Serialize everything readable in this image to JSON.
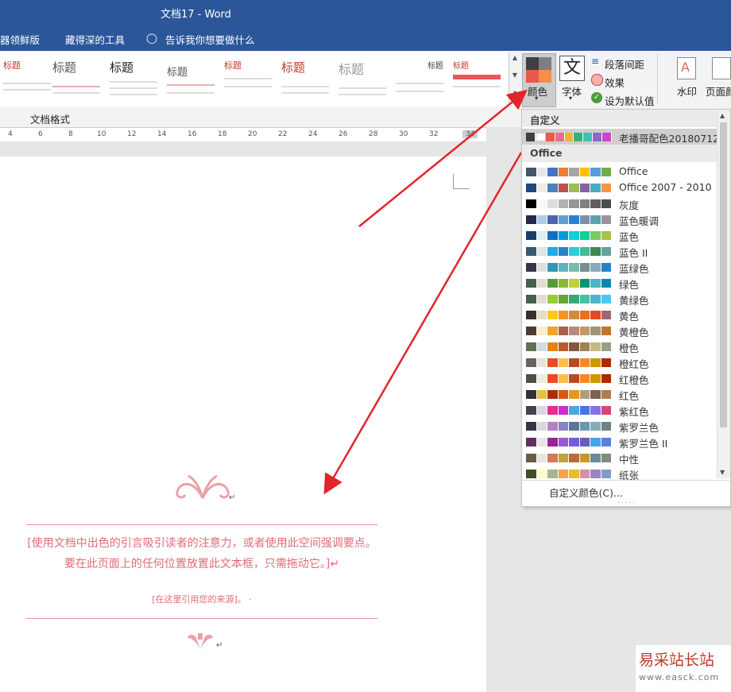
{
  "window": {
    "title": "文档17  -  Word"
  },
  "menubar": [
    "器领鲜版",
    "藏得深的工具",
    "告诉我你想要做什么"
  ],
  "ribbon": {
    "style_thumbs": [
      {
        "heading": "标题"
      },
      {
        "heading": "标题"
      },
      {
        "heading": "标题"
      },
      {
        "heading": "标题"
      },
      {
        "heading": "标题"
      },
      {
        "heading": "标题"
      },
      {
        "heading": "标题"
      },
      {
        "heading": "标题"
      },
      {
        "heading": "标题"
      }
    ],
    "colors_label": "颜色",
    "fonts_label": "字体",
    "paragraph_spacing_label": "段落间距",
    "effects_label": "效果",
    "set_default_label": "设为默认值",
    "watermark_label": "水印",
    "page_color_label": "页面颜",
    "doc_format_label": "文档格式"
  },
  "ruler": [
    "4",
    "6",
    "8",
    "10",
    "12",
    "14",
    "16",
    "18",
    "20",
    "22",
    "24",
    "26",
    "28",
    "30",
    "32",
    "34"
  ],
  "document": {
    "quote": "[使用文档中出色的引言吸引读者的注意力，或者使用此空间强调要点。要在此页面上的任何位置放置此文本框，只需拖动它。]↵",
    "source": "[在这里引用您的来源]。 ·",
    "para_mark": "↵"
  },
  "dropdown": {
    "custom_header": "自定义",
    "custom_items": [
      {
        "name": "老播哥配色20180712",
        "colors": [
          "#404040",
          "#ffffff",
          "#e8584b",
          "#ef6b88",
          "#f4b233",
          "#2fb37a",
          "#3dc0b4",
          "#9066c6",
          "#cc44cc"
        ]
      }
    ],
    "office_header": "Office",
    "office_items": [
      {
        "name": "Office",
        "colors": [
          "#44546a",
          "#e7e6e6",
          "#4472c4",
          "#ed7d31",
          "#a5a5a5",
          "#ffc000",
          "#5b9bd5",
          "#70ad47"
        ]
      },
      {
        "name": "Office 2007 - 2010",
        "colors": [
          "#1f497d",
          "#eeece1",
          "#4f81bd",
          "#c0504d",
          "#9bbb59",
          "#8064a2",
          "#4bacc6",
          "#f79646"
        ]
      },
      {
        "name": "灰度",
        "colors": [
          "#000000",
          "#f8f8f8",
          "#dddddd",
          "#b2b2b2",
          "#969696",
          "#808080",
          "#5f5f5f",
          "#4d4d4d"
        ]
      },
      {
        "name": "蓝色暖调",
        "colors": [
          "#242852",
          "#acccea",
          "#4a66ac",
          "#629dd1",
          "#297fd5",
          "#7f8fa9",
          "#5aa2ae",
          "#9d90a0"
        ]
      },
      {
        "name": "蓝色",
        "colors": [
          "#17406d",
          "#dbeff9",
          "#0f6fc6",
          "#009dd9",
          "#0bd0d9",
          "#10cf9b",
          "#7cca62",
          "#a5c249"
        ]
      },
      {
        "name": "蓝色 II",
        "colors": [
          "#335b74",
          "#dfe3e5",
          "#1cade4",
          "#2683c6",
          "#27ced7",
          "#42ba97",
          "#3e8853",
          "#62a39f"
        ]
      },
      {
        "name": "蓝绿色",
        "colors": [
          "#373545",
          "#dedede",
          "#3494ba",
          "#58b6c0",
          "#75bda7",
          "#7a8c8e",
          "#84acb6",
          "#2683c6"
        ]
      },
      {
        "name": "绿色",
        "colors": [
          "#455f51",
          "#e3ded1",
          "#549e39",
          "#8ab833",
          "#c0cf3a",
          "#029676",
          "#4ab5c4",
          "#0989b1"
        ]
      },
      {
        "name": "黄绿色",
        "colors": [
          "#455f51",
          "#e3ded1",
          "#99cb38",
          "#63a537",
          "#37a76f",
          "#44c1a3",
          "#4eb3cf",
          "#51c3f9"
        ]
      },
      {
        "name": "黄色",
        "colors": [
          "#39302a",
          "#e5dec9",
          "#ffca08",
          "#f8931d",
          "#ce8d3e",
          "#ec7016",
          "#e64823",
          "#9c6a6a"
        ]
      },
      {
        "name": "黄橙色",
        "colors": [
          "#4e3b30",
          "#fbeec9",
          "#f0a22e",
          "#a5644e",
          "#b58b80",
          "#c3986d",
          "#a19574",
          "#c17529"
        ]
      },
      {
        "name": "橙色",
        "colors": [
          "#637052",
          "#ccddea",
          "#e48312",
          "#bd582c",
          "#865640",
          "#9b8357",
          "#c2bc80",
          "#94a088"
        ]
      },
      {
        "name": "橙红色",
        "colors": [
          "#696464",
          "#e9e5dc",
          "#e84c22",
          "#ffbd47",
          "#b64926",
          "#ff8427",
          "#cc9900",
          "#b22600"
        ]
      },
      {
        "name": "红橙色",
        "colors": [
          "#505046",
          "#eeece1",
          "#e84c22",
          "#ffbd47",
          "#b64926",
          "#ff8427",
          "#cc9900",
          "#b22600"
        ]
      },
      {
        "name": "红色",
        "colors": [
          "#323232",
          "#e5c243",
          "#a5300f",
          "#d55816",
          "#e19825",
          "#b19c7d",
          "#7f5f52",
          "#b27d49"
        ]
      },
      {
        "name": "紫红色",
        "colors": [
          "#454551",
          "#d8d9dc",
          "#e32d91",
          "#c830cc",
          "#4ea6dc",
          "#4775e7",
          "#8971e1",
          "#d54773"
        ]
      },
      {
        "name": "紫罗兰色",
        "colors": [
          "#373545",
          "#dcd8dc",
          "#ad84c6",
          "#8784c7",
          "#5d739a",
          "#6997af",
          "#84acb6",
          "#6f8183"
        ]
      },
      {
        "name": "紫罗兰色 II",
        "colors": [
          "#632e62",
          "#eae5eb",
          "#92278f",
          "#9b57d3",
          "#755dd9",
          "#665eb8",
          "#45a5ed",
          "#5982db"
        ]
      },
      {
        "name": "中性",
        "colors": [
          "#695d46",
          "#e9e6df",
          "#d17a59",
          "#c2a33f",
          "#b86a3f",
          "#c4992b",
          "#6a8b9a",
          "#7f8c7e"
        ]
      },
      {
        "name": "纸张",
        "colors": [
          "#444d26",
          "#fefac9",
          "#a5b592",
          "#f3a447",
          "#e7bc29",
          "#d092a7",
          "#9c85c0",
          "#809ec2"
        ]
      }
    ],
    "custom_colors_label": "自定义颜色(C)...",
    "dots": "....."
  },
  "watermark_site": {
    "name": "易采站长站",
    "url": "www.easck.com"
  },
  "colors": {
    "accent": "#2b579a",
    "quote": "#e06b77",
    "arrow": "#e2252b"
  }
}
